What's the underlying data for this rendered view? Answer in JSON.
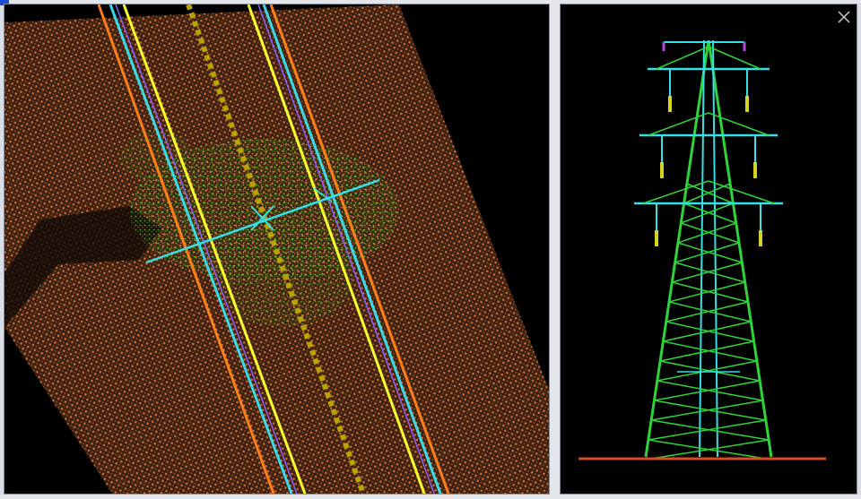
{
  "views": {
    "left": {
      "name": "plan-view",
      "background": "#000000",
      "ground_color": "#c5632e",
      "vegetation_color": "#3fcf2a"
    },
    "right": {
      "name": "tower-profile-view",
      "background": "#000000",
      "tower_color": "#2fd33a",
      "wire_color": "#35e0e6"
    }
  },
  "corridor_colors": {
    "outer_line": "#ff7f1a",
    "conductor_yellow": "#ffff2a",
    "conductor_cyan": "#37d9ea",
    "conductor_purple": "#8c5cff",
    "center_line": "#b8a300"
  },
  "icons": {
    "close": "close-icon"
  }
}
